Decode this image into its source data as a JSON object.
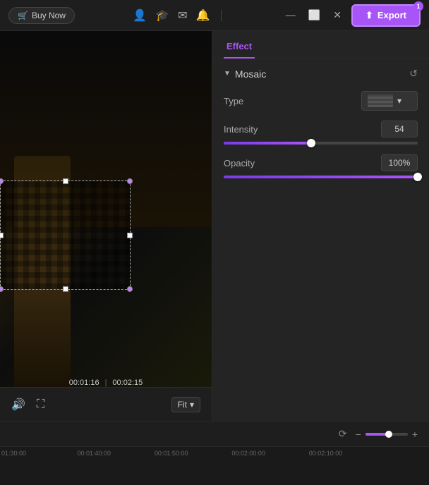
{
  "titlebar": {
    "buy_now_label": "Buy Now",
    "export_label": "Export",
    "export_badge": "1",
    "icons": [
      "user",
      "graduation-cap",
      "mail",
      "bell"
    ],
    "win_controls": [
      "minimize",
      "maximize",
      "close"
    ]
  },
  "video": {
    "timestamp_current": "00:01:16",
    "timestamp_total": "00:02:15",
    "timestamp_divider": "|",
    "fit_label": "Fit",
    "controls": {
      "volume": "🔊",
      "crop": "⛶"
    }
  },
  "effect_panel": {
    "tab_label": "Effect",
    "mosaic": {
      "section_title": "Mosaic",
      "type_label": "Type",
      "intensity_label": "Intensity",
      "intensity_value": "54",
      "opacity_label": "Opacity",
      "opacity_value": "100%"
    }
  },
  "timeline": {
    "ruler_labels": [
      "01:30:00",
      "00:01:40:00",
      "00:01:50:00",
      "00:02:00:00",
      "00:02:10:00"
    ],
    "zoom_icon_minus": "−",
    "zoom_icon_plus": "+",
    "refresh_icon": "⟳"
  }
}
